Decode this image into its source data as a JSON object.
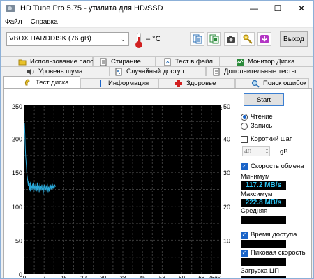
{
  "window": {
    "title": "HD Tune Pro 5.75 - утилита для HD/SSD",
    "minimize_glyph": "—",
    "maximize_glyph": "☐",
    "close_glyph": "✕"
  },
  "menu": {
    "file_label": "Файл",
    "help_label": "Справка"
  },
  "toolbar": {
    "drive": "VBOX HARDDISK (76 gB)",
    "temperature": "– °C",
    "exit_label": "Выход",
    "icons": [
      "copy-info-icon",
      "copy-screen-icon",
      "camera-icon",
      "options-key-icon",
      "save-down-arrow-icon"
    ]
  },
  "tabs": {
    "row1": [
      "Использование папок",
      "Стирание",
      "Тест в файл",
      "Монитор Диска"
    ],
    "row2": [
      "Уровень шума",
      "Случайный доступ",
      "Дополнительные тесты"
    ],
    "row3": [
      "Тест диска",
      "Информация",
      "Здоровье",
      "Поиск ошибок"
    ],
    "active": "Тест диска"
  },
  "side": {
    "start_label": "Start",
    "read_label": "Чтение",
    "write_label": "Запись",
    "mode_selected": "read",
    "short_stroke_label": "Короткий шаг",
    "short_stroke_checked": false,
    "short_stroke_value": "40",
    "short_stroke_unit": "gB",
    "transfer_rate_label": "Скорость обмена",
    "transfer_rate_checked": true,
    "min_label": "Минимум",
    "min_value": "117.2 MB/s",
    "max_label": "Максимум",
    "max_value": "222.8 MB/s",
    "avg_label": "Средняя",
    "access_time_label": "Время доступа",
    "access_time_checked": true,
    "burst_rate_label": "Пиковая скорость",
    "burst_rate_checked": true,
    "cpu_label": "Загрузка ЦП"
  },
  "chart_data": {
    "type": "line",
    "left_unit": "MB/s",
    "right_unit": "ms",
    "ylim_left": [
      0,
      250
    ],
    "ylim_right": [
      0,
      50
    ],
    "yticks_left": [
      "250",
      "200",
      "150",
      "100",
      "50",
      "0"
    ],
    "yticks_right": [
      "50",
      "40",
      "30",
      "20",
      "10"
    ],
    "xlim": [
      0,
      76
    ],
    "xticks": [
      "0",
      "7",
      "15",
      "22",
      "30",
      "38",
      "45",
      "53",
      "60",
      "68",
      "76gB"
    ],
    "grid": true,
    "background": "#000000",
    "line_color": "#2aa6d6",
    "series": [
      {
        "x": [
          0.0,
          0.15,
          0.3,
          0.45,
          0.6,
          0.75,
          0.9,
          1.05,
          1.2,
          1.35,
          1.5,
          1.65,
          1.8,
          1.95,
          2.1,
          2.25,
          2.4,
          2.55,
          2.7,
          2.85,
          3.0,
          3.15,
          3.3,
          3.45,
          3.6,
          3.75,
          3.9,
          4.05,
          4.2,
          4.35,
          4.5,
          4.65,
          4.8,
          4.95,
          5.1,
          5.25,
          5.4,
          5.55,
          5.7,
          5.85,
          6.0,
          6.15,
          6.3,
          6.45,
          6.6,
          6.75,
          6.9,
          7.05,
          7.2,
          7.35,
          7.5,
          7.65,
          7.8,
          7.95,
          8.1,
          8.25,
          8.4,
          8.55,
          8.7,
          8.85,
          9.0,
          9.15,
          9.3,
          9.45,
          9.6,
          9.75,
          9.9,
          10.05,
          10.2,
          10.35,
          10.5,
          10.65,
          10.8,
          10.95,
          11.1,
          11.25,
          11.4,
          11.55,
          11.7,
          11.85,
          12.0
        ],
        "y": [
          222.8,
          208,
          190,
          175,
          168,
          160,
          150,
          144,
          140,
          135,
          130,
          138,
          128,
          124,
          134,
          122,
          136,
          125,
          128,
          131,
          124,
          133,
          129,
          121,
          135,
          126,
          131,
          123,
          128,
          133,
          125,
          130,
          122,
          135,
          124,
          129,
          126,
          131,
          121,
          127,
          134,
          125,
          130,
          123,
          128,
          132,
          124,
          127,
          117.2,
          123,
          129,
          132,
          126,
          121,
          128,
          124,
          131,
          127,
          122,
          133,
          125,
          121,
          129,
          126,
          122,
          131,
          124,
          128,
          132,
          125,
          130,
          127,
          133,
          126,
          129,
          131,
          125,
          128,
          132,
          130,
          129
        ]
      }
    ]
  }
}
